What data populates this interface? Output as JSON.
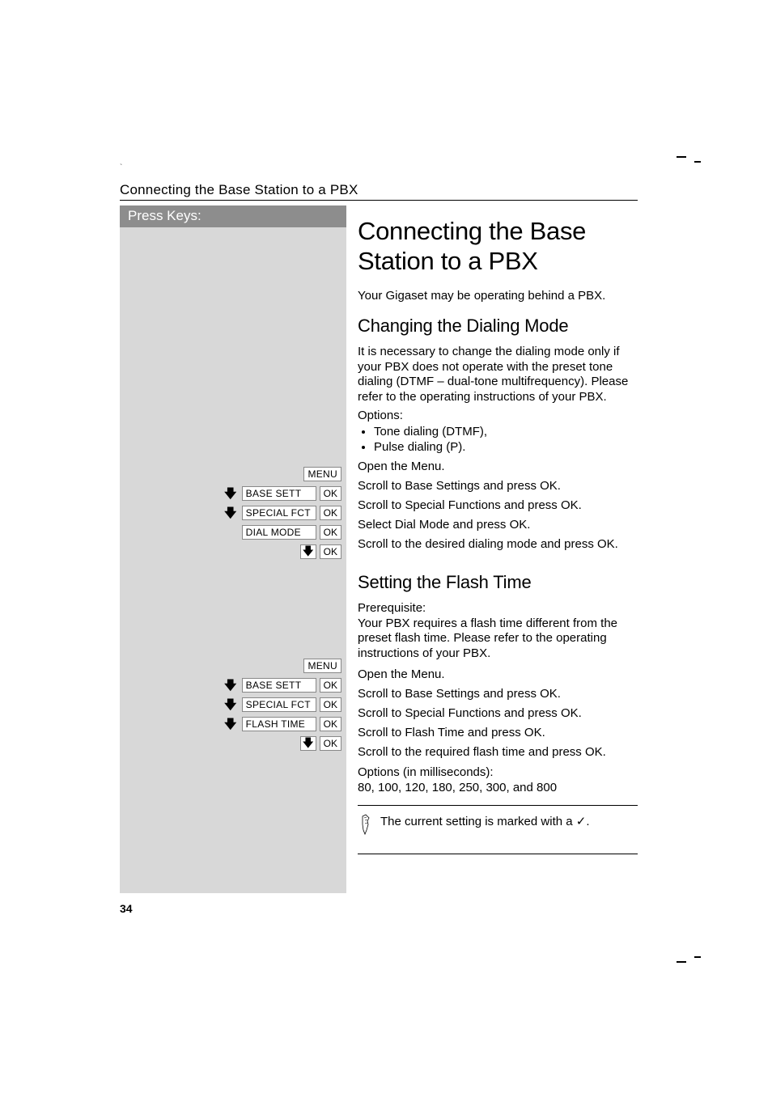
{
  "header": {
    "running": "Connecting the Base Station to a PBX"
  },
  "left": {
    "press_keys": "Press Keys:",
    "labels": {
      "menu": "MENU",
      "ok": "OK",
      "base_sett": "BASE SETT",
      "special_fct": "SPECIAL FCT",
      "dial_mode": "DIAL MODE",
      "flash_time": "FLASH TIME"
    }
  },
  "main": {
    "title": "Connecting the Base Station to a PBX",
    "intro": "Your Gigaset may be operating behind a PBX.",
    "section1": {
      "heading": "Changing the Dialing Mode",
      "para": "It is necessary to change the dialing mode only if your PBX does not operate with the preset tone dialing (DTMF – dual-tone multifrequency). Please refer to the operating instructions of your PBX.",
      "options_label": "Options:",
      "options": [
        "Tone dialing (DTMF),",
        "Pulse dialing (P)."
      ],
      "steps": [
        "Open the Menu.",
        "Scroll to Base Settings and press OK.",
        "Scroll to Special Functions and press OK.",
        "Select Dial Mode and press OK.",
        "Scroll to the desired dialing mode and press OK."
      ]
    },
    "section2": {
      "heading": "Setting the Flash Time",
      "prereq_label": "Prerequisite:",
      "prereq": "Your PBX requires a flash time different from the preset flash time. Please refer to the operating instructions of your PBX.",
      "steps": [
        "Open the Menu.",
        "Scroll to Base Settings and press OK.",
        "Scroll to Special Functions and press OK.",
        "Scroll to Flash Time and press OK.",
        "Scroll to the required flash time and press OK."
      ],
      "options_label": "Options (in milliseconds):",
      "options_line": "80, 100, 120, 180, 250, 300, and 800",
      "note": "The current setting is marked with a ✓."
    }
  },
  "page_number": "34",
  "chart_data": null
}
